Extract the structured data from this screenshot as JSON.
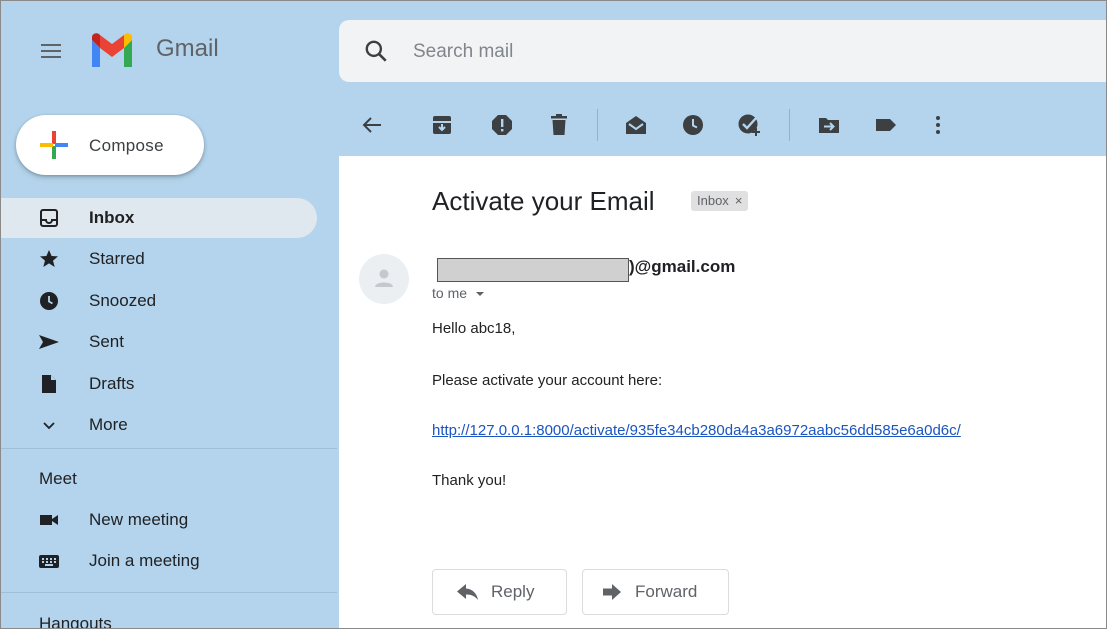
{
  "header": {
    "brand": "Gmail",
    "search_placeholder": "Search mail"
  },
  "compose": {
    "label": "Compose"
  },
  "sidebar": {
    "items": [
      {
        "label": "Inbox",
        "icon": "inbox-icon",
        "active": true
      },
      {
        "label": "Starred",
        "icon": "star-icon"
      },
      {
        "label": "Snoozed",
        "icon": "clock-icon"
      },
      {
        "label": "Sent",
        "icon": "send-icon"
      },
      {
        "label": "Drafts",
        "icon": "draft-icon"
      },
      {
        "label": "More",
        "icon": "chevron-down-icon"
      }
    ],
    "meet": {
      "title": "Meet",
      "items": [
        {
          "label": "New meeting",
          "icon": "video-icon"
        },
        {
          "label": "Join a meeting",
          "icon": "keyboard-icon"
        }
      ]
    },
    "hangouts_title": "Hangouts"
  },
  "toolbar": {
    "buttons": [
      "back-arrow-icon",
      "archive-icon",
      "report-spam-icon",
      "delete-icon",
      "mark-unread-icon",
      "snooze-icon",
      "add-task-icon",
      "move-to-icon",
      "label-icon",
      "more-vert-icon"
    ]
  },
  "email": {
    "subject": "Activate your Email",
    "label_chip": "Inbox",
    "label_chip_close": "×",
    "sender_suffix": ")@gmail.com",
    "recipient": "to me",
    "greeting": "Hello abc18,",
    "instruction": "Please activate your account here:",
    "link": "http://127.0.0.1:8000/activate/935fe34cb280da4a3a6972aabc56dd585e6a0d6c/",
    "closing": "Thank you!",
    "reply_label": "Reply",
    "forward_label": "Forward"
  },
  "colors": {
    "sidebar_bg": "#b3d4ec",
    "link": "#1a55c0",
    "active_item_bg": "#dfe8ef"
  }
}
